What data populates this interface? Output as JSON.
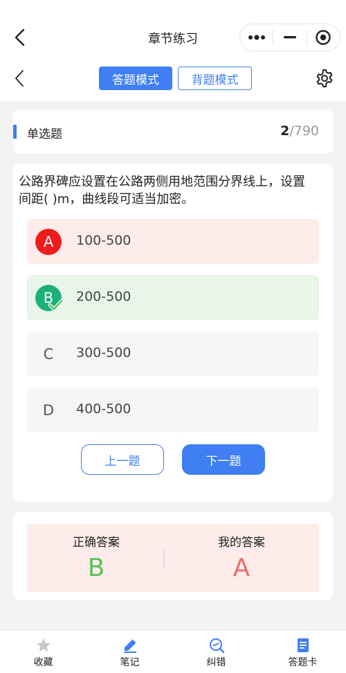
{
  "header": {
    "title": "章节练习"
  },
  "mode": {
    "answer_mode": "答题模式",
    "recite_mode": "背题模式"
  },
  "question": {
    "type": "单选题",
    "current": "2",
    "total": "/790",
    "text": "公路界碑应设置在公路两侧用地范围分界线上，设置间距( )m，曲线段可适当加密。",
    "options": [
      {
        "letter": "A",
        "text": "100-500",
        "state": "wrong"
      },
      {
        "letter": "B",
        "text": "200-500",
        "state": "right"
      },
      {
        "letter": "C",
        "text": "300-500",
        "state": "normal"
      },
      {
        "letter": "D",
        "text": "400-500",
        "state": "normal"
      }
    ]
  },
  "nav": {
    "prev": "上一题",
    "next": "下一题"
  },
  "answer": {
    "correct_label": "正确答案",
    "correct_value": "B",
    "mine_label": "我的答案",
    "mine_value": "A"
  },
  "tabbar": {
    "items": [
      "收藏",
      "笔记",
      "纠错",
      "答题卡"
    ]
  },
  "colors": {
    "accent": "#3f7ef3",
    "wrong": "#ee1c1c",
    "right": "#1cb07a"
  }
}
